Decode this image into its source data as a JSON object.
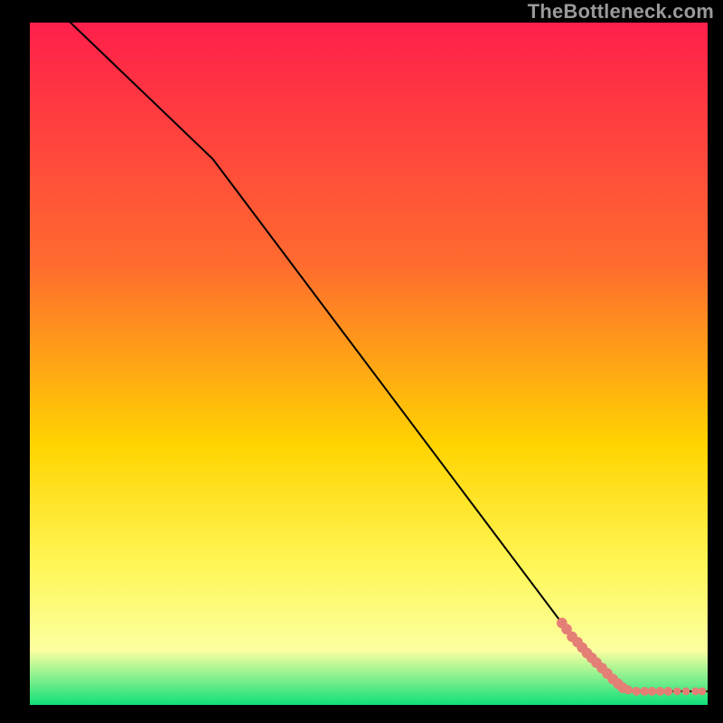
{
  "watermark": "TheBottleneck.com",
  "colors": {
    "frame_bg": "#000000",
    "gradient_top": "#ff1f4b",
    "gradient_mid1": "#ff6a2f",
    "gradient_mid2": "#ffd400",
    "gradient_mid3": "#fff759",
    "gradient_mid4": "#fbffa0",
    "gradient_bottom": "#10e07a",
    "line": "#000000",
    "dot": "#e47f76"
  },
  "chart_data": {
    "type": "line",
    "title": "",
    "xlabel": "",
    "ylabel": "",
    "xlim": [
      0,
      100
    ],
    "ylim": [
      0,
      100
    ],
    "series": [
      {
        "name": "curve",
        "x": [
          6,
          27,
          80,
          88,
          100
        ],
        "y": [
          100,
          80,
          10,
          2,
          2
        ]
      }
    ],
    "points": [
      {
        "x": 78.5,
        "y": 12.0,
        "r": 1.2
      },
      {
        "x": 79.2,
        "y": 11.1,
        "r": 1.2
      },
      {
        "x": 80.0,
        "y": 10.0,
        "r": 1.2
      },
      {
        "x": 80.8,
        "y": 9.2,
        "r": 1.2
      },
      {
        "x": 81.5,
        "y": 8.4,
        "r": 1.2
      },
      {
        "x": 82.2,
        "y": 7.6,
        "r": 1.2
      },
      {
        "x": 82.9,
        "y": 6.9,
        "r": 1.2
      },
      {
        "x": 83.6,
        "y": 6.2,
        "r": 1.2
      },
      {
        "x": 84.4,
        "y": 5.4,
        "r": 1.2
      },
      {
        "x": 85.2,
        "y": 4.6,
        "r": 1.2
      },
      {
        "x": 86.0,
        "y": 3.8,
        "r": 1.2
      },
      {
        "x": 86.8,
        "y": 3.1,
        "r": 1.2
      },
      {
        "x": 87.5,
        "y": 2.5,
        "r": 1.2
      },
      {
        "x": 88.3,
        "y": 2.2,
        "r": 1.0
      },
      {
        "x": 89.5,
        "y": 2.0,
        "r": 1.0
      },
      {
        "x": 90.7,
        "y": 2.0,
        "r": 1.0
      },
      {
        "x": 91.8,
        "y": 2.0,
        "r": 1.0
      },
      {
        "x": 93.0,
        "y": 2.0,
        "r": 1.0
      },
      {
        "x": 94.2,
        "y": 2.0,
        "r": 1.0
      },
      {
        "x": 95.5,
        "y": 2.0,
        "r": 0.9
      },
      {
        "x": 96.8,
        "y": 2.0,
        "r": 0.9
      },
      {
        "x": 98.2,
        "y": 2.0,
        "r": 0.9
      },
      {
        "x": 99.2,
        "y": 2.0,
        "r": 0.9
      }
    ]
  }
}
